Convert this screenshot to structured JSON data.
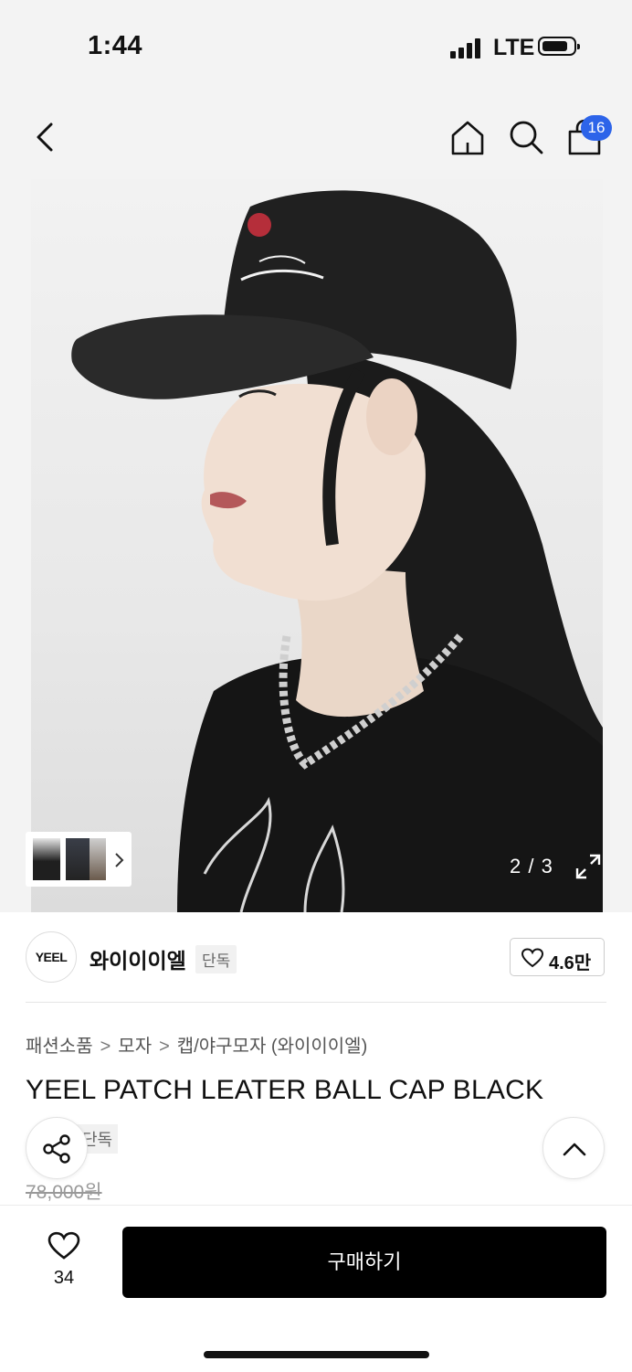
{
  "status_bar": {
    "time": "1:44",
    "network": "LTE",
    "battery_level": 0.8
  },
  "nav": {
    "cart_badge": "16",
    "badge_color": "#2d64e9"
  },
  "gallery": {
    "counter": "2 / 3",
    "current_image": 2,
    "total_images": 3
  },
  "brand": {
    "logo_text": "YEEL",
    "name": "와이이이엘",
    "tag": "단독",
    "likes": "4.6만"
  },
  "breadcrumb": [
    "패션소품",
    "모자",
    "캡/야구모자 (와이이이엘)"
  ],
  "product": {
    "title": "YEEL PATCH LEATER BALL CAP BLACK",
    "tag": "단독",
    "original_price": "78,000원"
  },
  "bottom_bar": {
    "wish_count": "34",
    "buy_label": "구매하기"
  },
  "icons": [
    "back-icon",
    "home-icon",
    "search-icon",
    "cart-icon",
    "expand-icon",
    "heart-icon",
    "share-icon",
    "chevron-up-icon",
    "chevron-right-icon"
  ]
}
